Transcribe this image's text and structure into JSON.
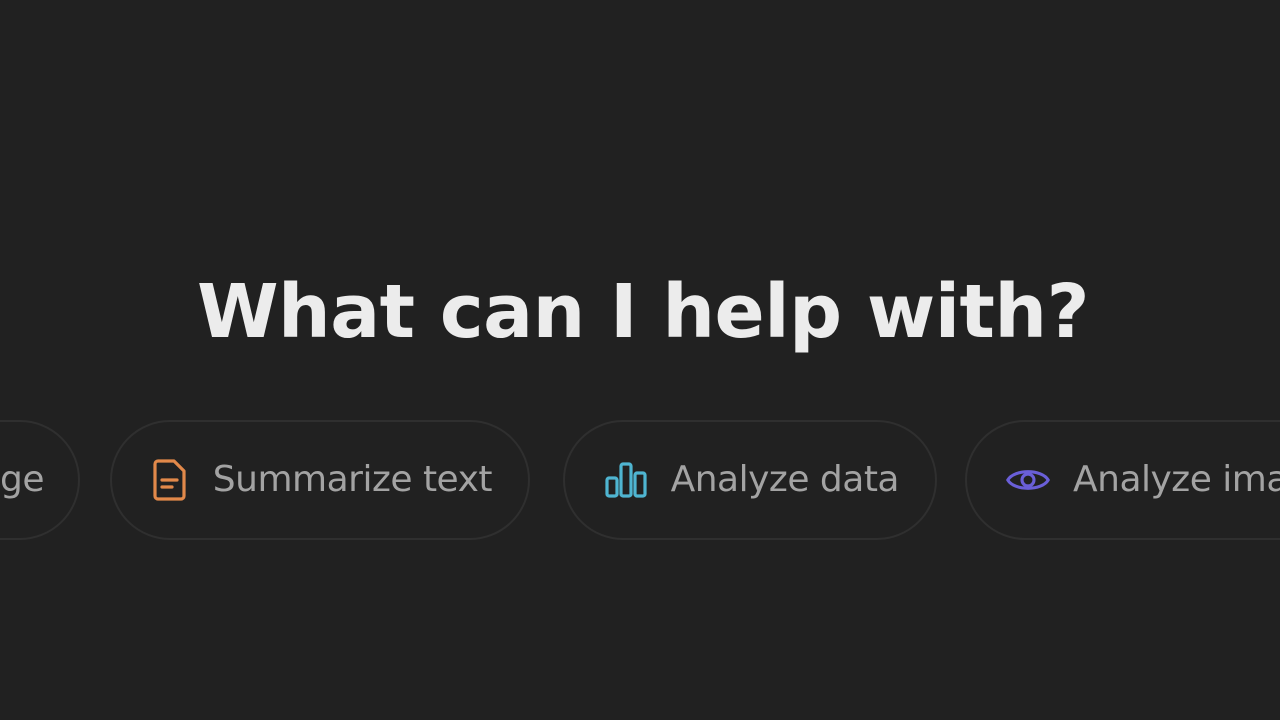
{
  "headline": "What can I help with?",
  "suggestions": [
    {
      "label": "ge",
      "icon": null
    },
    {
      "label": "Summarize text",
      "icon": "document-icon",
      "color": "#e2894a"
    },
    {
      "label": "Analyze data",
      "icon": "bar-chart-icon",
      "color": "#4fb5d1"
    },
    {
      "label": "Analyze ima",
      "icon": "eye-icon",
      "color": "#6a5fd8"
    }
  ]
}
